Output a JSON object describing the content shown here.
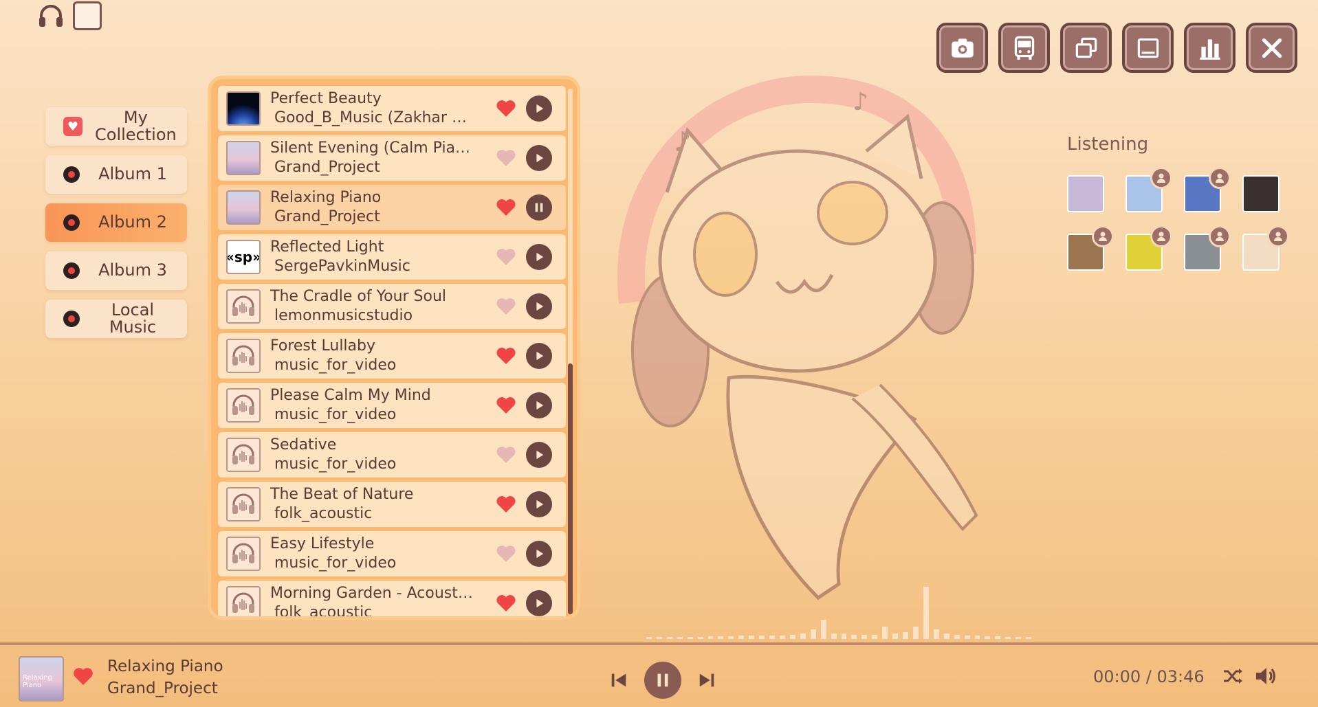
{
  "nav": {
    "items": [
      {
        "label": "My\nCollection",
        "icon": "heart-icon"
      },
      {
        "label": "Album 1",
        "icon": "disc-icon"
      },
      {
        "label": "Album 2",
        "icon": "disc-icon",
        "active": true
      },
      {
        "label": "Album 3",
        "icon": "disc-icon"
      },
      {
        "label": "Local Music",
        "icon": "disc-icon"
      }
    ]
  },
  "tracks": [
    {
      "title": "Perfect Beauty",
      "artist": "Good_B_Music (Zakhar Valaha)",
      "liked": true,
      "thumb": "space",
      "state": "play"
    },
    {
      "title": "Silent Evening (Calm Piano Music)",
      "artist": "Grand_Project",
      "liked": false,
      "thumb": "piano",
      "state": "play"
    },
    {
      "title": "Relaxing Piano",
      "artist": "Grand_Project",
      "liked": true,
      "thumb": "piano",
      "state": "pause"
    },
    {
      "title": "Reflected Light",
      "artist": "SergePavkinMusic",
      "liked": false,
      "thumb": "sp",
      "state": "play"
    },
    {
      "title": "The Cradle of Your Soul",
      "artist": "lemonmusicstudio",
      "liked": false,
      "thumb": "headphones",
      "state": "play"
    },
    {
      "title": "Forest Lullaby",
      "artist": "music_for_video",
      "liked": true,
      "thumb": "headphones",
      "state": "play"
    },
    {
      "title": "Please Calm My Mind",
      "artist": "music_for_video",
      "liked": true,
      "thumb": "headphones",
      "state": "play"
    },
    {
      "title": "Sedative",
      "artist": "music_for_video",
      "liked": false,
      "thumb": "headphones",
      "state": "play"
    },
    {
      "title": "The Beat of Nature",
      "artist": "folk_acoustic",
      "liked": true,
      "thumb": "headphones",
      "state": "play"
    },
    {
      "title": "Easy Lifestyle",
      "artist": "music_for_video",
      "liked": false,
      "thumb": "headphones",
      "state": "play"
    },
    {
      "title": "Morning Garden - Acoustic Chill",
      "artist": "folk_acoustic",
      "liked": true,
      "thumb": "headphones",
      "state": "play"
    }
  ],
  "listening": {
    "title": "Listening",
    "avatars": [
      {
        "name": "avatar-1",
        "color": "#c7b8d8",
        "badge": false
      },
      {
        "name": "avatar-2",
        "color": "#a9c4e8",
        "badge": true
      },
      {
        "name": "avatar-3",
        "color": "#5876c4",
        "badge": true
      },
      {
        "name": "avatar-4",
        "color": "#3a3030",
        "badge": false
      },
      {
        "name": "avatar-5",
        "color": "#9b7550",
        "badge": true
      },
      {
        "name": "avatar-6",
        "color": "#e2d23a",
        "badge": true
      },
      {
        "name": "avatar-7",
        "color": "#8a8f93",
        "badge": true
      },
      {
        "name": "avatar-8",
        "color": "#f3dcc4",
        "badge": true
      }
    ]
  },
  "now_playing": {
    "title": "Relaxing Piano",
    "artist": "Grand_Project",
    "cover_text": "Relaxing Piano",
    "time": "00:00 / 03:46",
    "liked": true
  },
  "window_buttons": [
    "camera-icon",
    "bus-icon",
    "restore-icon",
    "minimize-icon",
    "chart-icon",
    "close-icon"
  ],
  "colors": {
    "accent": "#f99556",
    "brown": "#6b4540",
    "heart": "#ef4545",
    "heart_off": "#e7b7b6"
  }
}
